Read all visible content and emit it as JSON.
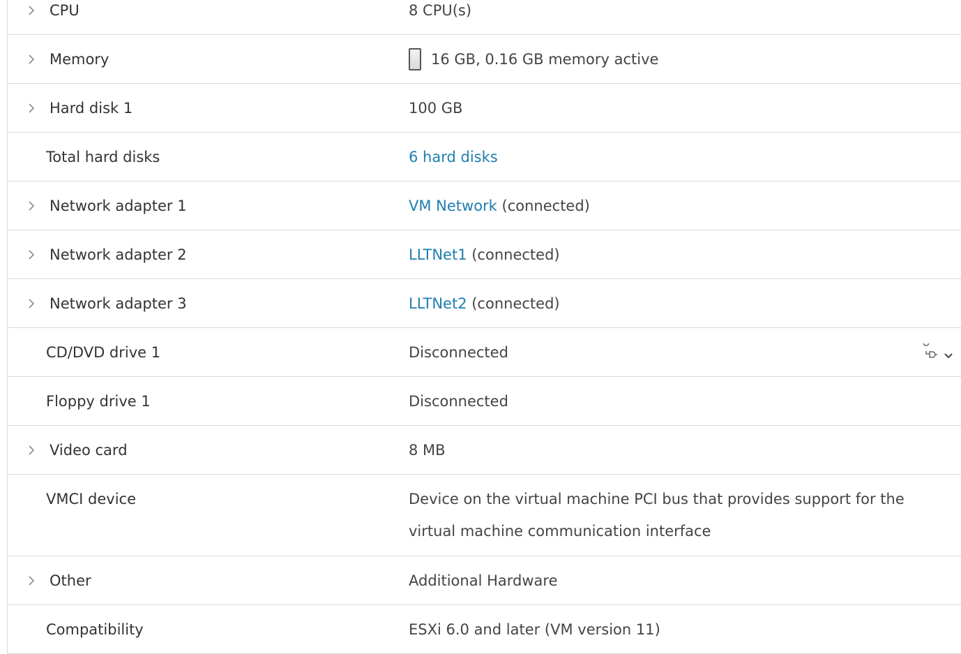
{
  "rows": [
    {
      "label": "CPU",
      "value": "8 CPU(s)"
    },
    {
      "label": "Memory",
      "value": "16 GB, 0.16 GB memory active"
    },
    {
      "label": "Hard disk 1",
      "value": "100 GB"
    },
    {
      "label": "Total hard disks",
      "link": "6 hard disks"
    },
    {
      "label": "Network adapter 1",
      "link": "VM Network",
      "suffix": " (connected)"
    },
    {
      "label": "Network adapter 2",
      "link": "LLTNet1",
      "suffix": " (connected)"
    },
    {
      "label": "Network adapter 3",
      "link": "LLTNet2",
      "suffix": " (connected)"
    },
    {
      "label": "CD/DVD drive 1",
      "value": "Disconnected"
    },
    {
      "label": "Floppy drive 1",
      "value": "Disconnected"
    },
    {
      "label": "Video card",
      "value": "8 MB"
    },
    {
      "label": "VMCI device",
      "value": "Device on the virtual machine PCI bus that provides support for the virtual machine communication interface"
    },
    {
      "label": "Other",
      "value": "Additional Hardware"
    },
    {
      "label": "Compatibility",
      "value": "ESXi 6.0 and later (VM version 11)"
    }
  ],
  "icons": {
    "expand": "chevron-right-icon",
    "memory": "memory-bar-icon",
    "connect": "connect-plug-icon",
    "dropdown": "chevron-down-icon"
  },
  "colors": {
    "link": "#1f7eae",
    "divider": "#d9d9d9",
    "text": "#333333"
  }
}
